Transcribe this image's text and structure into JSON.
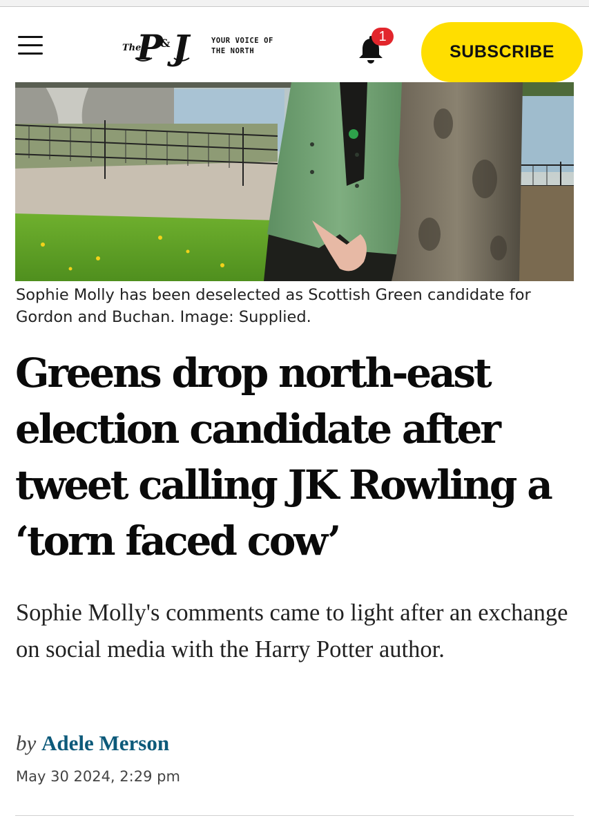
{
  "header": {
    "logo_text": "The P&J",
    "tagline_line1": "YOUR VOICE OF",
    "tagline_line2": "THE NORTH",
    "notification_count": "1",
    "subscribe_label": "SUBSCRIBE"
  },
  "article": {
    "image_caption": "Sophie Molly has been deselected as Scottish Green candidate for Gordon and Buchan. Image: Supplied.",
    "headline": "Greens drop north-east election candidate after tweet calling JK Rowling a ‘torn faced cow’",
    "standfirst": "Sophie Molly's comments came to light after an exchange on social media with the Harry Potter author.",
    "byline_prefix": "by",
    "author": "Adele Merson",
    "date": "May 30 2024, 2:29 pm"
  },
  "colors": {
    "subscribe_bg": "#ffde00",
    "badge": "#e2262c",
    "author_link": "#0d5a7a"
  },
  "icons": {
    "menu": "hamburger-menu-icon",
    "notifications": "bell-icon"
  }
}
